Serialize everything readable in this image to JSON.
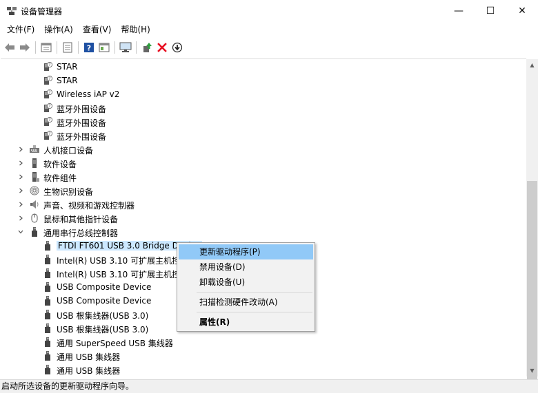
{
  "window": {
    "title": "设备管理器",
    "minimize_glyph": "—",
    "maximize_glyph": "☐",
    "close_glyph": "✕"
  },
  "menu": {
    "items": [
      "文件(F)",
      "操作(A)",
      "查看(V)",
      "帮助(H)"
    ]
  },
  "toolbar": {
    "buttons": [
      "back-arrow-icon",
      "forward-arrow-icon",
      "properties-icon",
      "view-icon",
      "help-icon",
      "resources-icon",
      "monitor-icon",
      "update-driver-icon",
      "uninstall-icon",
      "download-icon"
    ]
  },
  "tree": {
    "rows": [
      {
        "label": "STAR",
        "icon": "bluetooth-device-icon",
        "expand": ""
      },
      {
        "label": "STAR",
        "icon": "bluetooth-device-icon",
        "expand": ""
      },
      {
        "label": "Wireless iAP v2",
        "icon": "bluetooth-device-icon",
        "expand": ""
      },
      {
        "label": "蓝牙外围设备",
        "icon": "bluetooth-device-icon",
        "expand": ""
      },
      {
        "label": "蓝牙外围设备",
        "icon": "bluetooth-device-icon",
        "expand": ""
      },
      {
        "label": "蓝牙外围设备",
        "icon": "bluetooth-device-icon",
        "expand": ""
      },
      {
        "label": "人机接口设备",
        "icon": "hid-icon",
        "expand": "collapsed"
      },
      {
        "label": "软件设备",
        "icon": "software-device-icon",
        "expand": "collapsed"
      },
      {
        "label": "软件组件",
        "icon": "software-component-icon",
        "expand": "collapsed"
      },
      {
        "label": "生物识别设备",
        "icon": "fingerprint-icon",
        "expand": "collapsed"
      },
      {
        "label": "声音、视频和游戏控制器",
        "icon": "speaker-icon",
        "expand": "collapsed"
      },
      {
        "label": "鼠标和其他指针设备",
        "icon": "mouse-icon",
        "expand": "collapsed"
      },
      {
        "label": "通用串行总线控制器",
        "icon": "usb-icon",
        "expand": "expanded"
      },
      {
        "label": "FTDI FT601 USB 3.0 Bridge Device",
        "icon": "usb-icon",
        "expand": "",
        "selected": true
      },
      {
        "label": "Intel(R) USB 3.10 可扩展主机控制器 - 1.20 (Microsoft)",
        "icon": "usb-icon",
        "expand": ""
      },
      {
        "label": "Intel(R) USB 3.10 可扩展主机控制器 - 1.20 (Microsoft)",
        "icon": "usb-icon",
        "expand": ""
      },
      {
        "label": "USB Composite Device",
        "icon": "usb-icon",
        "expand": ""
      },
      {
        "label": "USB Composite Device",
        "icon": "usb-icon",
        "expand": ""
      },
      {
        "label": "USB 根集线器(USB 3.0)",
        "icon": "usb-icon",
        "expand": ""
      },
      {
        "label": "USB 根集线器(USB 3.0)",
        "icon": "usb-icon",
        "expand": ""
      },
      {
        "label": "通用 SuperSpeed USB 集线器",
        "icon": "usb-icon",
        "expand": ""
      },
      {
        "label": "通用 USB 集线器",
        "icon": "usb-icon",
        "expand": ""
      },
      {
        "label": "通用 USB 集线器",
        "icon": "usb-icon",
        "expand": ""
      }
    ]
  },
  "context_menu": {
    "items": [
      {
        "label": "更新驱动程序(P)",
        "hover": true
      },
      {
        "label": "禁用设备(D)"
      },
      {
        "label": "卸载设备(U)"
      },
      {
        "label": "扫描检测硬件改动(A)"
      },
      {
        "label": "属性(R)",
        "bold": true
      }
    ]
  },
  "status": {
    "text": "启动所选设备的更新驱动程序向导。"
  },
  "colors": {
    "selection": "#cce8ff",
    "menu_hover": "#91c9f7",
    "uninstall_red": "#e81123",
    "help_blue": "#1e50a2"
  }
}
